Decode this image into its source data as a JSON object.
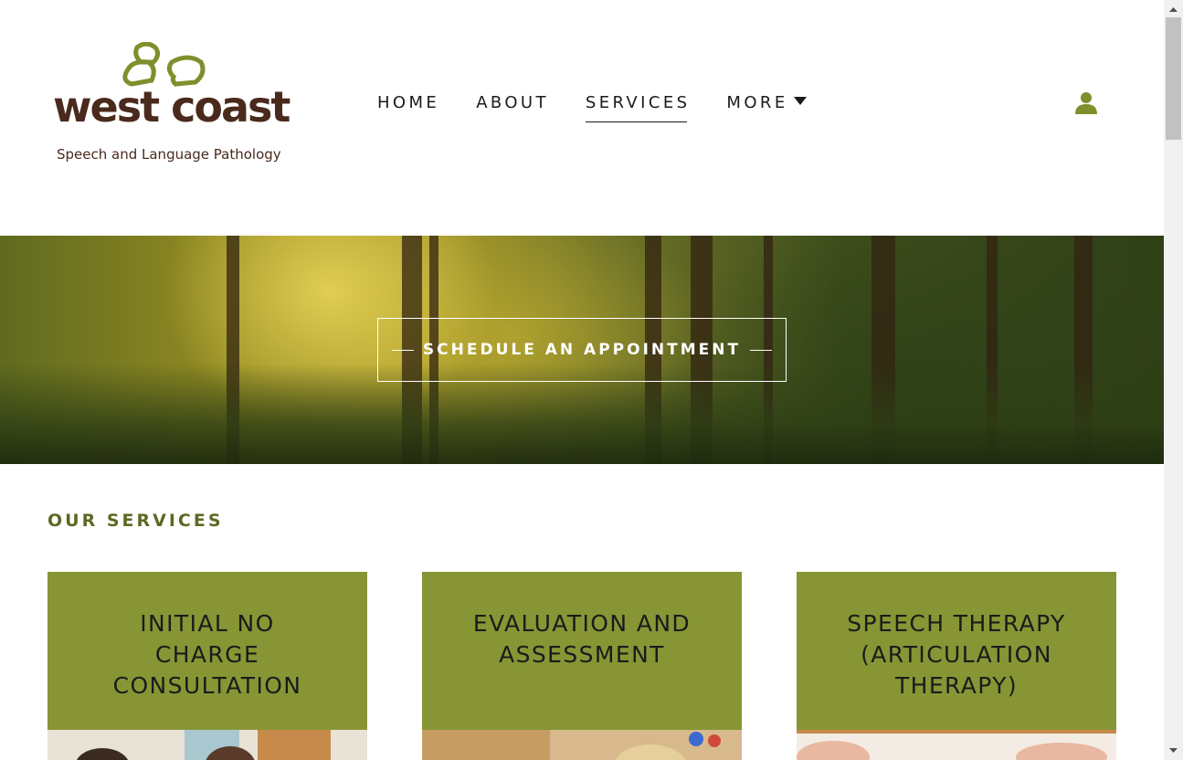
{
  "brand": {
    "name_part1": "west",
    "name_part2": "coast",
    "tagline": "Speech and Language Pathology",
    "brand_color": "#7e8f2c",
    "text_color": "#4a2a1c"
  },
  "nav": {
    "items": [
      {
        "label": "HOME"
      },
      {
        "label": "ABOUT"
      },
      {
        "label": "SERVICES",
        "active": true
      },
      {
        "label": "MORE",
        "has_dropdown": true
      }
    ],
    "account_icon": "user-icon"
  },
  "hero": {
    "cta_label": "SCHEDULE AN APPOINTMENT"
  },
  "services": {
    "section_title": "OUR SERVICES",
    "card_color": "#879535",
    "cards": [
      {
        "title": "INITIAL NO\nCHARGE\nCONSULTATION"
      },
      {
        "title": "EVALUATION AND\nASSESSMENT"
      },
      {
        "title": "SPEECH THERAPY\n(ARTICULATION\nTHERAPY)"
      }
    ]
  }
}
